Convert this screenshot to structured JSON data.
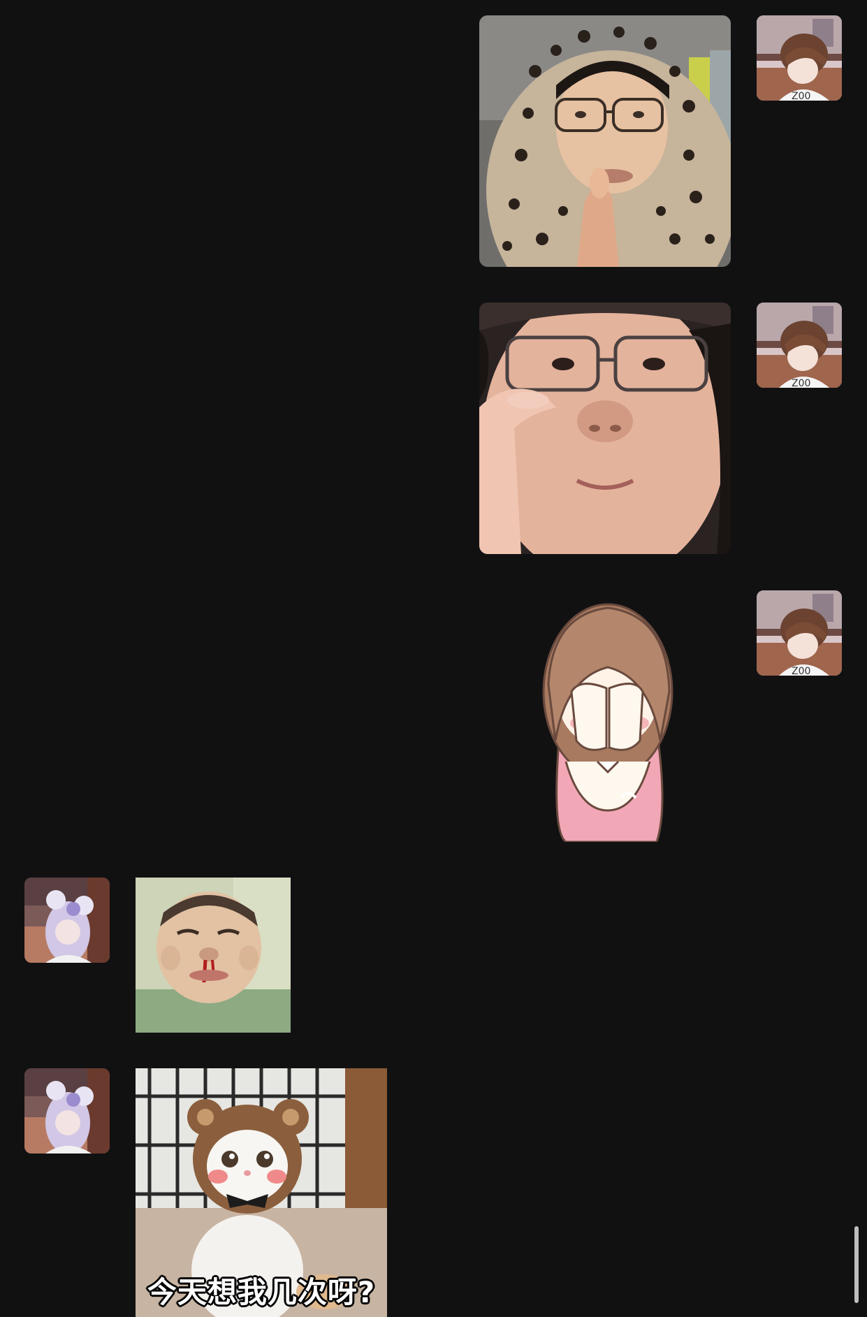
{
  "chat": {
    "messages": [
      {
        "id": "m1",
        "side": "right",
        "kind": "photo",
        "description": "woman-leopard-hood-pointing"
      },
      {
        "id": "m2",
        "side": "right",
        "kind": "photo",
        "description": "woman-glasses-closeup"
      },
      {
        "id": "m3",
        "side": "right",
        "kind": "sticker",
        "description": "cartoon-girl-covering-face"
      },
      {
        "id": "m4",
        "side": "left",
        "kind": "photo",
        "description": "baby-nosebleed-meme"
      },
      {
        "id": "m5",
        "side": "left",
        "kind": "photo",
        "description": "cat-bear-hat-meme",
        "caption": "今天想我几次呀?"
      }
    ]
  },
  "colors": {
    "background": "#111112",
    "scrollbar": "#bdbdbd"
  }
}
